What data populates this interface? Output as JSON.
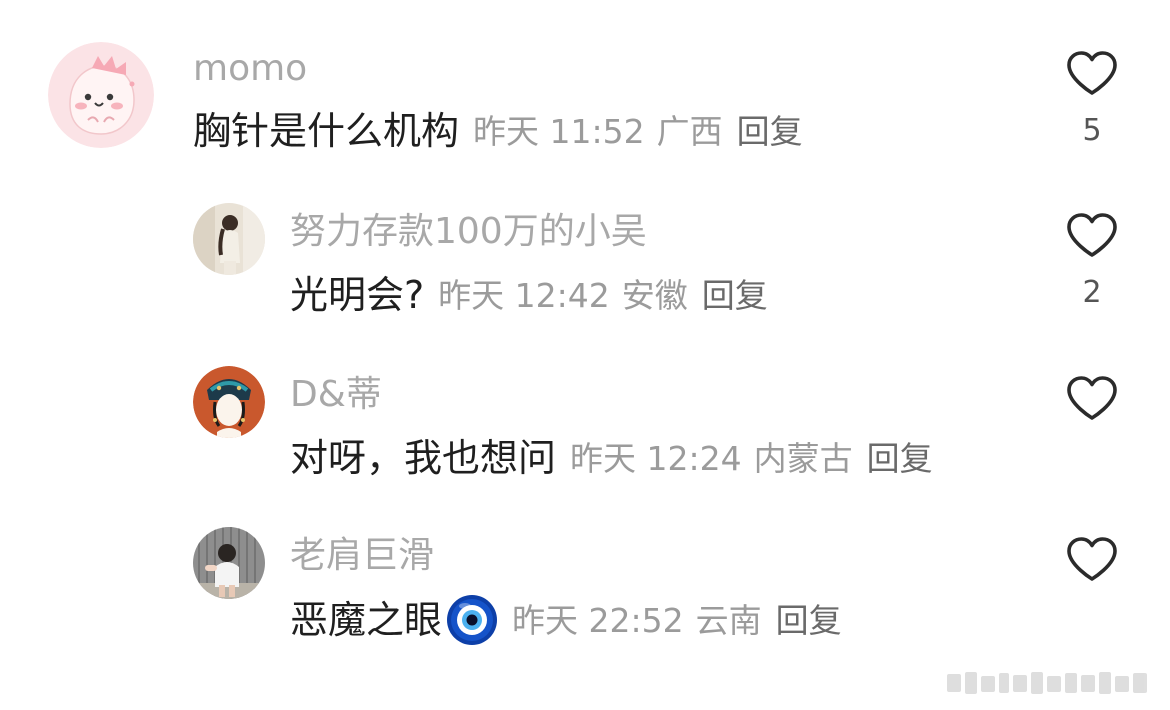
{
  "comments": [
    {
      "username": "momo",
      "content": "胸针是什么机构",
      "time": "昨天 11:52",
      "location": "广西",
      "reply_label": "回复",
      "likes": "5",
      "avatar_icon": "pink-dinosaur-avatar"
    },
    {
      "username": "努力存款100万的小吴",
      "content": "光明会?",
      "time": "昨天 12:42",
      "location": "安徽",
      "reply_label": "回复",
      "likes": "2",
      "avatar_icon": "girl-photo-avatar"
    },
    {
      "username": "D&蒂",
      "content": "对呀，我也想问",
      "time": "昨天 12:24",
      "location": "内蒙古",
      "reply_label": "回复",
      "likes": "",
      "avatar_icon": "qing-dynasty-lady-avatar"
    },
    {
      "username": "老肩巨滑",
      "content": "恶魔之眼",
      "emoji": "nazar-amulet-emoji",
      "time": "昨天 22:52",
      "location": "云南",
      "reply_label": "回复",
      "likes": "",
      "avatar_icon": "child-photo-avatar"
    }
  ],
  "colors": {
    "username": "#a8a8a8",
    "meta": "#9b9b9b",
    "content": "#1f1f1f",
    "heart_outline": "#2b2b2b"
  }
}
